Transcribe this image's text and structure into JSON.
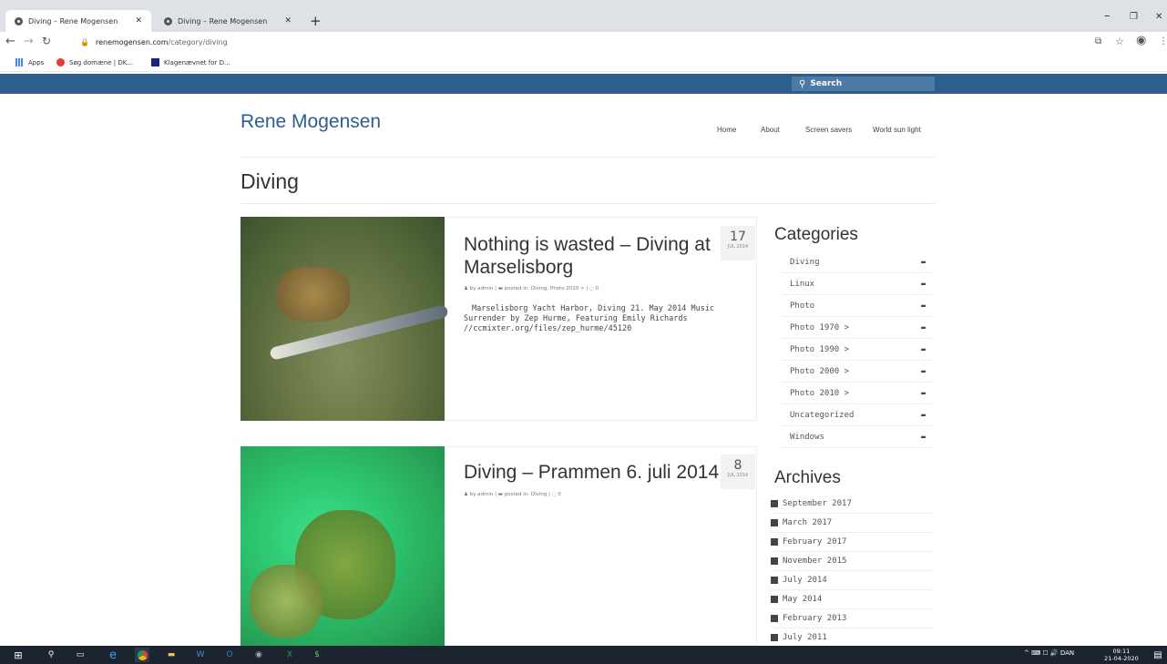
{
  "browser": {
    "tabs": [
      {
        "title": "Diving – Rene Mogensen"
      },
      {
        "title": "Diving – Rene Mogensen"
      }
    ],
    "new_tab": "+",
    "window_controls": [
      "–",
      "❐",
      "✕"
    ],
    "url_domain": "renemogensen.com",
    "url_path": "/category/diving",
    "bookmarks": [
      {
        "label": "Apps"
      },
      {
        "label": "Søg domæne | DK..."
      },
      {
        "label": "Klagenævnet for D..."
      }
    ]
  },
  "site": {
    "search_placeholder": "Search",
    "title": "Rene Mogensen",
    "menu": [
      "Home",
      "About",
      "Screen savers",
      "World sun light"
    ],
    "page_title": "Diving"
  },
  "posts": [
    {
      "title": "Nothing is wasted – Diving at Marselisborg",
      "day": "17",
      "month": "JUL 2014",
      "author": "by admin |",
      "cats": "posted in: Diving, Photo 2010 > |",
      "comments": "0",
      "excerpt": "Marselisborg Yacht Harbor, Diving 21. May 2014 Music Surrender by Zep Hurme, Featuring Emily Richards //ccmixter.org/files/zep_hurme/45120"
    },
    {
      "title": "Diving – Prammen 6. juli 2014",
      "day": "8",
      "month": "JUL 2014",
      "author": "by admin |",
      "cats": "posted in: Diving |",
      "comments": "0",
      "excerpt": ""
    }
  ],
  "sidebar": {
    "categories_title": "Categories",
    "categories": [
      "Diving",
      "Linux",
      "Photo",
      "Photo 1970 >",
      "Photo 1990 >",
      "Photo 2000 >",
      "Photo 2010 >",
      "Uncategorized",
      "Windows"
    ],
    "archives_title": "Archives",
    "archives": [
      "September 2017",
      "March 2017",
      "February 2017",
      "November 2015",
      "July 2014",
      "May 2014",
      "February 2013",
      "July 2011"
    ]
  },
  "taskbar": {
    "tray": "^  ⌨  ☐  🔊  DAN",
    "time": "09:11",
    "date": "21-04-2020"
  }
}
